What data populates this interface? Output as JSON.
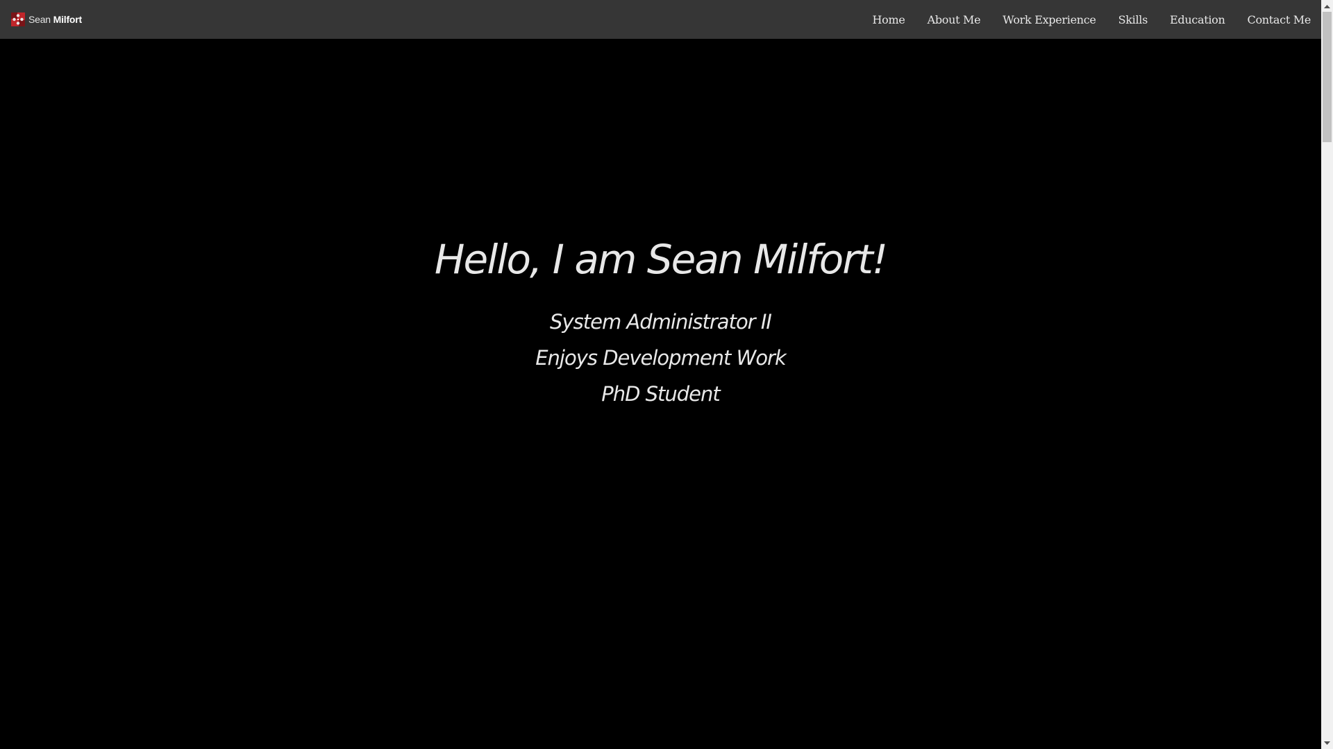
{
  "brand": {
    "first_name": "Sean",
    "last_name": "Milfort",
    "logo_icon": "puzzle-logo-icon",
    "logo_color": "#c0262b"
  },
  "nav": {
    "items": [
      {
        "label": "Home"
      },
      {
        "label": "About Me"
      },
      {
        "label": "Work Experience"
      },
      {
        "label": "Skills"
      },
      {
        "label": "Education"
      },
      {
        "label": "Contact Me"
      }
    ]
  },
  "hero": {
    "title": "Hello, I am Sean Milfort!",
    "subtitles": [
      "System Administrator II",
      "Enjoys Development Work",
      "PhD Student"
    ]
  },
  "colors": {
    "navbar_bg": "#363636",
    "page_bg": "#000000",
    "text": "#e8e8e8"
  }
}
